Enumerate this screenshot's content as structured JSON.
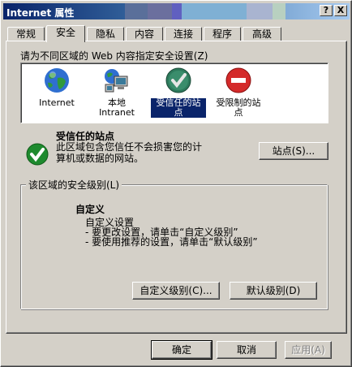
{
  "window": {
    "title": "Internet 属性",
    "help_button": "?",
    "close_button": "X"
  },
  "tabs": [
    "常规",
    "安全",
    "隐私",
    "内容",
    "连接",
    "程序",
    "高级"
  ],
  "active_tab": "安全",
  "zones_prompt": "请为不同区域的 Web 内容指定安全设置(Z)",
  "zones": [
    {
      "label": "Internet",
      "icon": "globe-icon"
    },
    {
      "label": "本地\nIntranet",
      "icon": "local-intranet-icon"
    },
    {
      "label": "受信任的站\n点",
      "icon": "trusted-sites-icon"
    },
    {
      "label": "受限制的站\n点",
      "icon": "restricted-sites-icon"
    }
  ],
  "selected_zone": {
    "name": "受信任的站点",
    "description": "此区域包含您信任不会损害您的计\n算机或数据的网站。",
    "sites_button": "站点(S)..."
  },
  "security_level": {
    "group_title": "该区域的安全级别(L)",
    "level_name": "自定义",
    "lines": [
      "自定义设置",
      "- 要更改设置，请单击“自定义级别”",
      "- 要使用推荐的设置，请单击“默认级别”"
    ],
    "custom_button": "自定义级别(C)...",
    "default_button": "默认级别(D)"
  },
  "footer": {
    "ok": "确定",
    "cancel": "取消",
    "apply": "应用(A)"
  },
  "colors": {
    "title_start": "#0a246a",
    "title_end": "#a6caf0",
    "face": "#d4d0c8",
    "selection": "#0a246a"
  }
}
